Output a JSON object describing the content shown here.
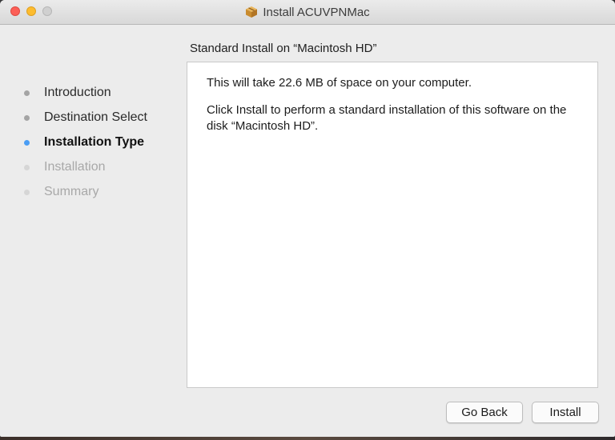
{
  "window": {
    "title": "Install ACUVPNMac",
    "title_icon": "package-icon"
  },
  "pane": {
    "heading": "Standard Install on “Macintosh HD”",
    "paragraphs": [
      "This will take 22.6 MB of space on your computer.",
      "Click Install to perform a standard installation of this software on the disk “Macintosh HD”."
    ]
  },
  "sidebar": {
    "steps": [
      {
        "label": "Introduction",
        "state": "done"
      },
      {
        "label": "Destination Select",
        "state": "done"
      },
      {
        "label": "Installation Type",
        "state": "current"
      },
      {
        "label": "Installation",
        "state": "future"
      },
      {
        "label": "Summary",
        "state": "future"
      }
    ]
  },
  "buttons": {
    "go_back": "Go Back",
    "install": "Install"
  },
  "colors": {
    "current_step_dot": "#4a9df4",
    "done_step_dot": "#a4a4a4",
    "future_step_dot": "#d6d6d6",
    "close": "#fc5f57",
    "minimize": "#fdbc2e"
  }
}
